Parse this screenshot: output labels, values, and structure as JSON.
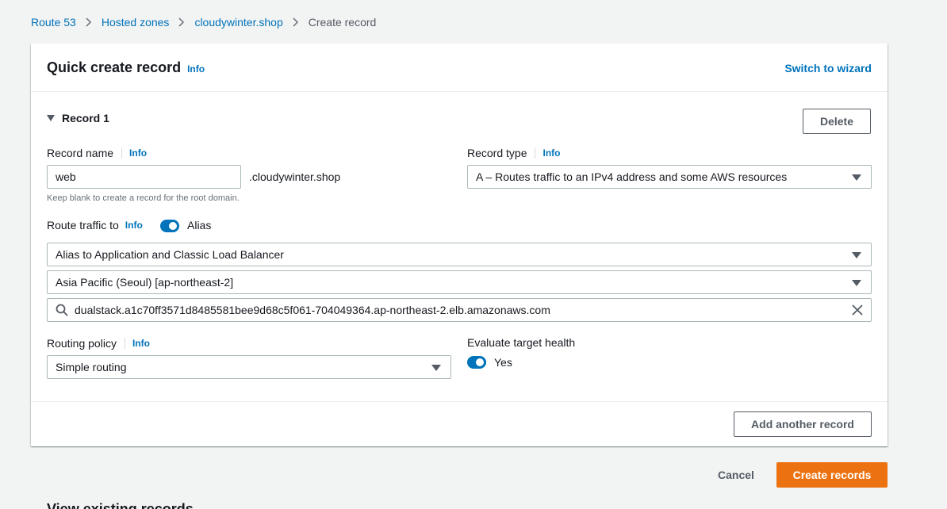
{
  "breadcrumb": {
    "items": [
      "Route 53",
      "Hosted zones",
      "cloudywinter.shop"
    ],
    "current": "Create record"
  },
  "panel": {
    "title": "Quick create record",
    "info": "Info",
    "switch_link": "Switch to wizard"
  },
  "record": {
    "heading": "Record 1",
    "delete_label": "Delete",
    "name_label": "Record name",
    "name_info": "Info",
    "name_value": "web",
    "name_suffix": ".cloudywinter.shop",
    "name_hint": "Keep blank to create a record for the root domain.",
    "type_label": "Record type",
    "type_info": "Info",
    "type_value": "A – Routes traffic to an IPv4 address and some AWS resources",
    "route_label": "Route traffic to",
    "route_info": "Info",
    "alias_label": "Alias",
    "alias_enabled": true,
    "endpoint_value": "Alias to Application and Classic Load Balancer",
    "region_value": "Asia Pacific (Seoul) [ap-northeast-2]",
    "lb_value": "dualstack.a1c70ff3571d8485581bee9d68c5f061-704049364.ap-northeast-2.elb.amazonaws.com",
    "policy_label": "Routing policy",
    "policy_info": "Info",
    "policy_value": "Simple routing",
    "health_label": "Evaluate target health",
    "health_value": "Yes",
    "health_enabled": true
  },
  "add_another_label": "Add another record",
  "footer": {
    "cancel_label": "Cancel",
    "create_label": "Create records"
  },
  "next_section_title": "View existing records",
  "colors": {
    "link": "#0073bb",
    "primary": "#ec7211",
    "background": "#f2f3f3"
  }
}
